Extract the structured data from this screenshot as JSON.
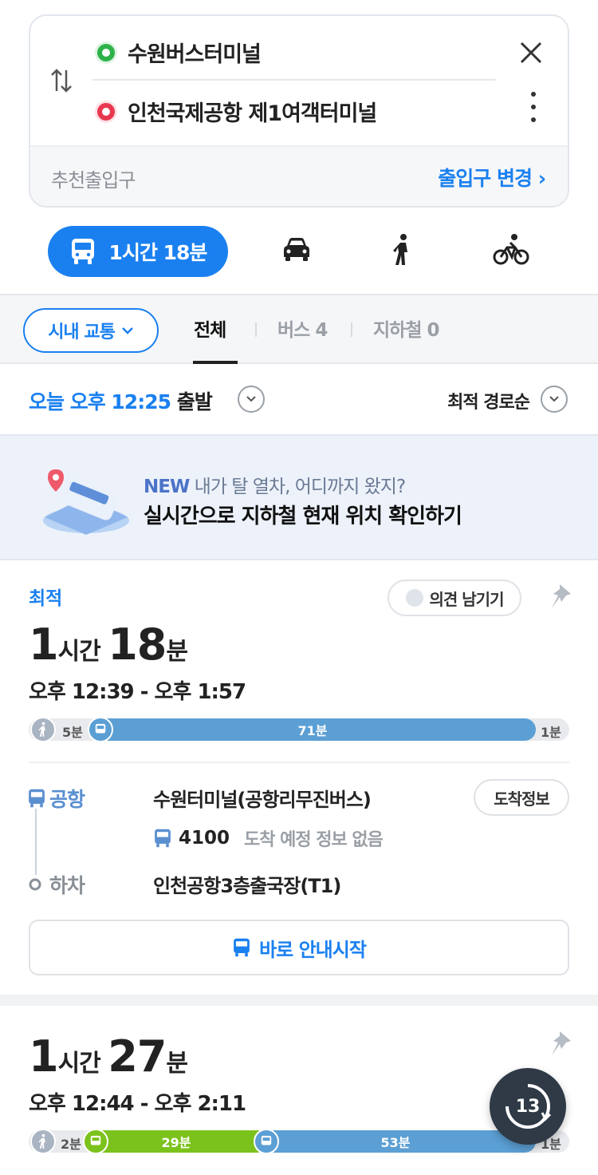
{
  "route": {
    "origin": "수원버스터미널",
    "destination": "인천국제공항 제1여객터미널",
    "entrance_label": "추천출입구",
    "entrance_change": "출입구 변경 ›"
  },
  "modes": {
    "transit_time": "1시간 18분"
  },
  "filters": {
    "category": "시내 교통",
    "tabs": [
      "전체",
      "버스 4",
      "지하철 0"
    ]
  },
  "departure": {
    "prefix": "오늘 오후 12:25",
    "suffix": " 출발",
    "sort": "최적 경로순"
  },
  "banner": {
    "new": "NEW",
    "line1": " 내가 탈 열차, 어디까지 왔지?",
    "line2": "실시간으로 지하철 현재 위치 확인하기"
  },
  "results": [
    {
      "badge": "최적",
      "feedback": "의견 남기기",
      "dur_h": "1",
      "dur_h_unit": "시간 ",
      "dur_m": "18",
      "dur_m_unit": "분",
      "times": "오후 12:39 - 오후 1:57",
      "walk1": "5분",
      "bus": "71분",
      "walk2": "1분",
      "board_label": "공항",
      "board_stop": "수원터미널(공항리무진버스)",
      "arrival_btn": "도착정보",
      "bus_number": "4100",
      "bus_note": "도착 예정 정보 없음",
      "alight_label": "하차",
      "alight_stop": "인천공항3층출국장(T1)",
      "start": "바로 안내시작"
    },
    {
      "dur_h": "1",
      "dur_h_unit": "시간 ",
      "dur_m": "27",
      "dur_m_unit": "분",
      "times": "오후 12:44 - 오후 2:11",
      "walk1": "2분",
      "bus_a": "29분",
      "bus_b": "53분",
      "walk2": "1분"
    }
  ],
  "fab": {
    "count": "13"
  },
  "colors": {
    "accent": "#1a80f0",
    "bus_blue": "#5b9fd4",
    "bus_green": "#7cc21c",
    "origin": "#2db24a",
    "destination": "#e8384f"
  }
}
